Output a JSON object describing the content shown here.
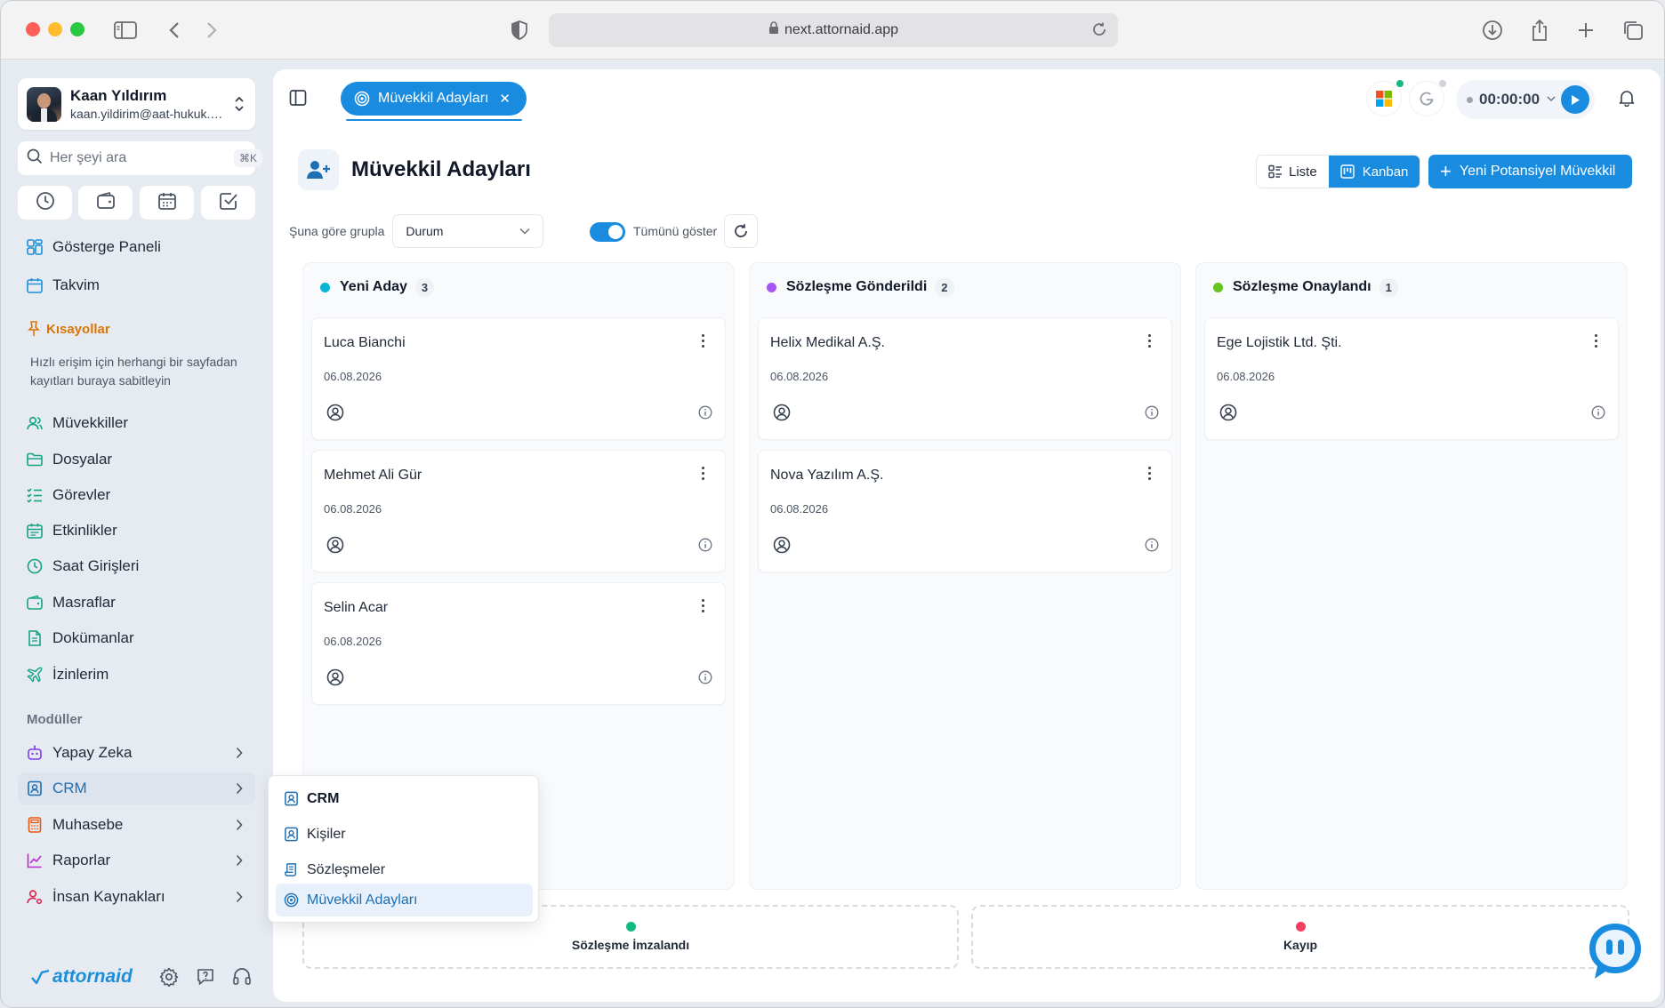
{
  "browser": {
    "url": "next.attornaid.app"
  },
  "user": {
    "name": "Kaan Yıldırım",
    "email": "kaan.yildirim@aat-hukuk.com"
  },
  "search": {
    "placeholder": "Her şeyi ara",
    "shortcut": "⌘K"
  },
  "nav": {
    "dashboard": "Gösterge Paneli",
    "calendar": "Takvim",
    "shortcuts_title": "Kısayollar",
    "shortcuts_help": "Hızlı erişim için herhangi bir sayfadan kayıtları buraya sabitleyin",
    "clients": "Müvekkiller",
    "files": "Dosyalar",
    "tasks": "Görevler",
    "events": "Etkinlikler",
    "time_entries": "Saat Girişleri",
    "expenses": "Masraflar",
    "documents": "Dokümanlar",
    "leaves": "İzinlerim",
    "modules_title": "Modüller",
    "ai": "Yapay Zeka",
    "crm": "CRM",
    "accounting": "Muhasebe",
    "reports": "Raporlar",
    "hr": "İnsan Kaynakları"
  },
  "brand": "attornaid",
  "crm_menu": {
    "title": "CRM",
    "contacts": "Kişiler",
    "contracts": "Sözleşmeler",
    "leads": "Müvekkil Adayları"
  },
  "topbar": {
    "tab_label": "Müvekkil Adayları",
    "timer": "00:00:00"
  },
  "page": {
    "title": "Müvekkil Adayları",
    "view_list": "Liste",
    "view_kanban": "Kanban",
    "new_button": "Yeni Potansiyel Müvekkil",
    "group_by_label": "Şuna göre grupla",
    "group_by_value": "Durum",
    "show_all_label": "Tümünü göster"
  },
  "columns": [
    {
      "title": "Yeni Aday",
      "count": "3",
      "color": "#06b6d4",
      "cards": [
        {
          "title": "Luca Bianchi",
          "date": "06.08.2026"
        },
        {
          "title": "Mehmet Ali Gür",
          "date": "06.08.2026"
        },
        {
          "title": "Selin Acar",
          "date": "06.08.2026"
        }
      ]
    },
    {
      "title": "Sözleşme Gönderildi",
      "count": "2",
      "color": "#a855f7",
      "cards": [
        {
          "title": "Helix Medikal A.Ş.",
          "date": "06.08.2026"
        },
        {
          "title": "Nova Yazılım A.Ş.",
          "date": "06.08.2026"
        }
      ]
    },
    {
      "title": "Sözleşme Onaylandı",
      "count": "1",
      "color": "#65c322",
      "cards": [
        {
          "title": "Ege Lojistik Ltd. Şti.",
          "date": "06.08.2026"
        }
      ]
    }
  ],
  "drop_zones": [
    {
      "label": "Sözleşme İmzalandı",
      "color": "#10b981"
    },
    {
      "label": "Kayıp",
      "color": "#f43f5e"
    }
  ]
}
